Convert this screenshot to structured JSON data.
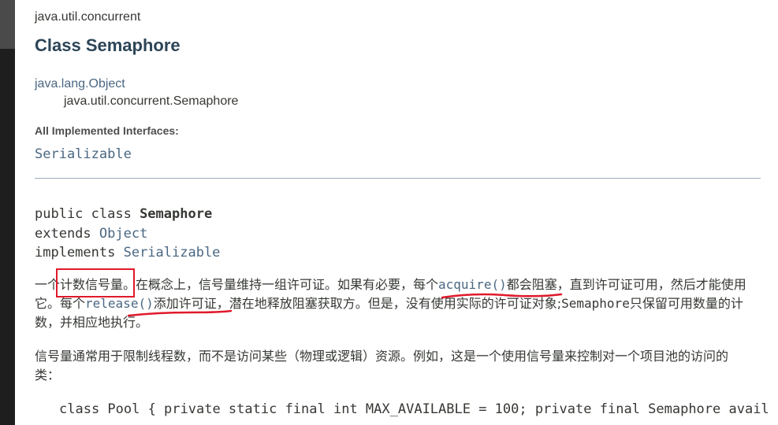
{
  "package_name": "java.util.concurrent",
  "class_title": "Class Semaphore",
  "hierarchy": {
    "parent": "java.lang.Object",
    "child": "java.util.concurrent.Semaphore"
  },
  "implemented": {
    "label": "All Implemented Interfaces:",
    "value": "Serializable"
  },
  "signature": {
    "line1_kw": "public class ",
    "line1_name": "Semaphore",
    "line2_kw": "extends ",
    "line2_link": "Object",
    "line3_kw": "implements ",
    "line3_link": "Serializable"
  },
  "description": {
    "p1_a": "一个计数信号量。在概念上，信号量维持一组许可证。如果有必要，每个",
    "p1_acquire": "acquire()",
    "p1_b": "都会阻塞，直到许可证可用，然后才能使用它。每个",
    "p1_release": "release()",
    "p1_c": "添加许可证，潜在地释放阻塞获取方。但是，没有使用实际的许可证对象;",
    "p1_sem": "Semaphore",
    "p1_d": "只保留可用数量的计数，并相应地执行。",
    "p2": "信号量通常用于限制线程数，而不是访问某些（物理或逻辑）资源。例如，这是一个使用信号量来控制对一个项目池的访问的类："
  },
  "code_line": "class Pool { private static final int MAX_AVAILABLE = 100; private final Semaphore avail",
  "annotation_color": "#e0192a"
}
